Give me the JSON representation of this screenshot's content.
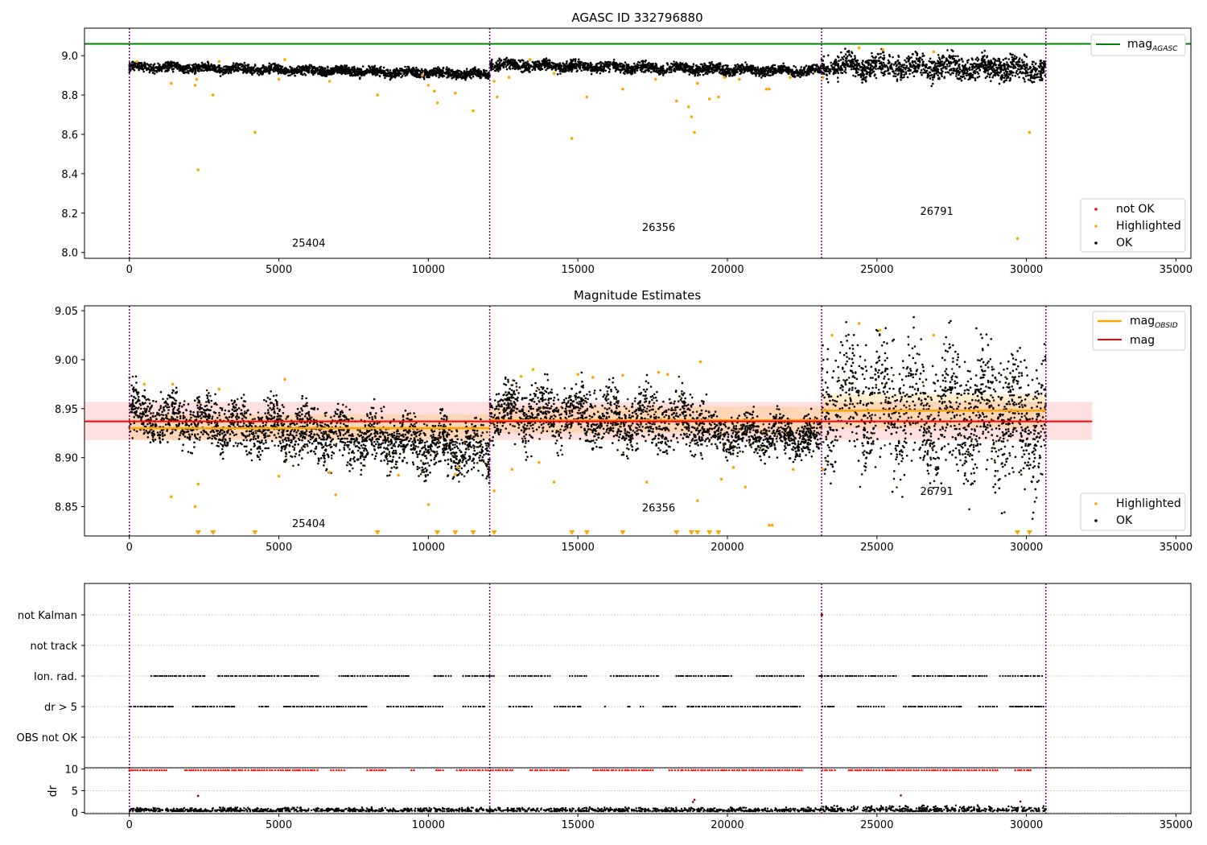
{
  "chart_data": [
    {
      "type": "scatter",
      "title": "AGASC ID 332796880",
      "xlim": [
        -1500,
        35500
      ],
      "ylim": [
        7.97,
        9.14
      ],
      "xticks": [
        0,
        5000,
        10000,
        15000,
        20000,
        25000,
        30000,
        35000
      ],
      "yticks": [
        8.0,
        8.2,
        8.4,
        8.6,
        8.8,
        9.0
      ],
      "yticklabels": [
        "8.0",
        "8.2",
        "8.4",
        "8.6",
        "8.8",
        "9.0"
      ],
      "vlines": [
        0,
        12050,
        23150,
        30650
      ],
      "segments": [
        {
          "label": "25404",
          "x": 6000,
          "y": 8.03
        },
        {
          "label": "26356",
          "x": 17700,
          "y": 8.11
        },
        {
          "label": "26791",
          "x": 27000,
          "y": 8.19
        }
      ],
      "band_means": [
        {
          "x0": 0,
          "x1": 12050,
          "y0": 8.945,
          "y1": 8.905,
          "half": 0.018
        },
        {
          "x0": 12050,
          "x1": 23150,
          "y0": 8.955,
          "y1": 8.92,
          "half": 0.02
        },
        {
          "x0": 23150,
          "x1": 30650,
          "y0": 8.95,
          "y1": 8.93,
          "half": 0.045
        }
      ],
      "mag_agasc": 9.06,
      "highlighted": [
        [
          250,
          8.97
        ],
        [
          1400,
          8.86
        ],
        [
          2200,
          8.85
        ],
        [
          2250,
          8.88
        ],
        [
          2300,
          8.42
        ],
        [
          2800,
          8.8
        ],
        [
          3000,
          8.97
        ],
        [
          4200,
          8.61
        ],
        [
          5000,
          8.88
        ],
        [
          5200,
          8.98
        ],
        [
          6700,
          8.87
        ],
        [
          8300,
          8.8
        ],
        [
          9800,
          8.9
        ],
        [
          10000,
          8.85
        ],
        [
          10200,
          8.82
        ],
        [
          10300,
          8.76
        ],
        [
          10900,
          8.81
        ],
        [
          11500,
          8.72
        ],
        [
          12200,
          8.87
        ],
        [
          12300,
          8.79
        ],
        [
          12700,
          8.89
        ],
        [
          13400,
          8.98
        ],
        [
          14200,
          8.91
        ],
        [
          14800,
          8.58
        ],
        [
          15300,
          8.79
        ],
        [
          16500,
          8.83
        ],
        [
          17600,
          8.88
        ],
        [
          18300,
          8.77
        ],
        [
          18700,
          8.74
        ],
        [
          18800,
          8.69
        ],
        [
          18900,
          8.61
        ],
        [
          19000,
          8.86
        ],
        [
          19400,
          8.78
        ],
        [
          19700,
          8.79
        ],
        [
          19900,
          8.89
        ],
        [
          20400,
          8.88
        ],
        [
          21300,
          8.83
        ],
        [
          21400,
          8.83
        ],
        [
          22100,
          8.89
        ],
        [
          23200,
          8.89
        ],
        [
          24400,
          9.04
        ],
        [
          25200,
          9.03
        ],
        [
          26900,
          9.02
        ],
        [
          29700,
          8.07
        ],
        [
          30100,
          8.61
        ]
      ],
      "legend_lines": [
        {
          "label": "mag",
          "sub": "AGASC",
          "color": "#008000"
        }
      ],
      "legend_markers": [
        {
          "label": "not OK",
          "color": "#ff0000"
        },
        {
          "label": "Highlighted",
          "color": "#ffa500"
        },
        {
          "label": "OK",
          "color": "#000000"
        }
      ]
    },
    {
      "type": "scatter",
      "title": "Magnitude Estimates",
      "xlim": [
        -1500,
        35500
      ],
      "ylim": [
        8.82,
        9.055
      ],
      "xticks": [
        0,
        5000,
        10000,
        15000,
        20000,
        25000,
        30000,
        35000
      ],
      "yticks": [
        8.85,
        8.9,
        8.95,
        9.0,
        9.05
      ],
      "yticklabels": [
        "8.85",
        "8.90",
        "8.95",
        "9.00",
        "9.05"
      ],
      "vlines": [
        0,
        12050,
        23150,
        30650
      ],
      "segments": [
        {
          "label": "25404",
          "x": 6000,
          "y": 8.829
        },
        {
          "label": "26356",
          "x": 17700,
          "y": 8.845
        },
        {
          "label": "26791",
          "x": 27000,
          "y": 8.862
        }
      ],
      "mag": 8.937,
      "mag_band": [
        8.918,
        8.957
      ],
      "mag_line_x": [
        -1500,
        32200
      ],
      "mag_obsid": [
        {
          "x0": 0,
          "x1": 12050,
          "y": 8.93,
          "lo": 8.918,
          "hi": 8.944
        },
        {
          "x0": 12050,
          "x1": 23150,
          "y": 8.938,
          "lo": 8.925,
          "hi": 8.952
        },
        {
          "x0": 23150,
          "x1": 30650,
          "y": 8.948,
          "lo": 8.93,
          "hi": 8.965
        }
      ],
      "band_means": [
        {
          "x0": 0,
          "x1": 12050,
          "y0": 8.945,
          "y1": 8.905,
          "half": 0.02
        },
        {
          "x0": 12050,
          "x1": 19300,
          "y0": 8.948,
          "y1": 8.935,
          "half": 0.022
        },
        {
          "x0": 19300,
          "x1": 23150,
          "y0": 8.925,
          "y1": 8.92,
          "half": 0.015
        },
        {
          "x0": 23150,
          "x1": 30650,
          "y0": 8.96,
          "y1": 8.935,
          "half": 0.05
        }
      ],
      "highlighted": [
        [
          500,
          8.975
        ],
        [
          1400,
          8.86
        ],
        [
          1450,
          8.975
        ],
        [
          2200,
          8.85
        ],
        [
          2300,
          8.873
        ],
        [
          3000,
          8.97
        ],
        [
          5000,
          8.881
        ],
        [
          5200,
          8.98
        ],
        [
          6700,
          8.885
        ],
        [
          6900,
          8.862
        ],
        [
          9000,
          8.882
        ],
        [
          10000,
          8.852
        ],
        [
          10900,
          8.883
        ],
        [
          11000,
          8.89
        ],
        [
          12200,
          8.866
        ],
        [
          12800,
          8.888
        ],
        [
          13100,
          8.983
        ],
        [
          13500,
          8.99
        ],
        [
          13700,
          8.895
        ],
        [
          14200,
          8.875
        ],
        [
          15000,
          8.985
        ],
        [
          15500,
          8.982
        ],
        [
          16500,
          8.984
        ],
        [
          17300,
          8.875
        ],
        [
          17700,
          8.987
        ],
        [
          18000,
          8.985
        ],
        [
          19000,
          8.856
        ],
        [
          19100,
          8.998
        ],
        [
          19800,
          8.878
        ],
        [
          20200,
          8.89
        ],
        [
          20600,
          8.87
        ],
        [
          21400,
          8.831
        ],
        [
          21500,
          8.831
        ],
        [
          22200,
          8.888
        ],
        [
          23200,
          8.888
        ],
        [
          23500,
          9.025
        ],
        [
          24400,
          9.037
        ],
        [
          25100,
          9.03
        ],
        [
          26900,
          9.025
        ]
      ],
      "offscale": [
        2300,
        2800,
        4200,
        8300,
        10300,
        10900,
        11500,
        12200,
        14800,
        15300,
        16500,
        18300,
        18800,
        19000,
        19400,
        19700,
        29700,
        30100
      ],
      "legend_lines": [
        {
          "label": "mag",
          "sub": "OBSID",
          "color": "#ffa500"
        },
        {
          "label": "mag",
          "sub": "",
          "color": "#ff0000"
        }
      ],
      "legend_markers": [
        {
          "label": "Highlighted",
          "color": "#ffa500"
        },
        {
          "label": "OK",
          "color": "#000000"
        }
      ]
    },
    {
      "type": "scatter",
      "title": "",
      "xlim": [
        -1500,
        35500
      ],
      "vlines": [
        0,
        12050,
        23150,
        30650
      ],
      "categories": [
        "not Kalman",
        "not track",
        "Ion. rad.",
        "dr > 5",
        "OBS not OK"
      ],
      "flag_rows": [
        "Ion. rad.",
        "dr > 5"
      ],
      "not_kalman_points": [
        [
          23160,
          "not Kalman"
        ]
      ]
    },
    {
      "type": "scatter",
      "title": "",
      "xlim": [
        -1500,
        35500
      ],
      "ylim": [
        -0.3,
        10.3
      ],
      "xticks": [
        0,
        5000,
        10000,
        15000,
        20000,
        25000,
        30000,
        35000
      ],
      "yticks": [
        0,
        5,
        10
      ],
      "yticklabels": [
        "0",
        "5",
        "10"
      ],
      "ylabel": "dr",
      "vlines": [
        0,
        12050,
        23150,
        30650
      ],
      "dr_outliers": [
        [
          2300,
          3.8
        ],
        [
          18850,
          2.4
        ],
        [
          18900,
          2.9
        ],
        [
          25800,
          3.9
        ],
        [
          29800,
          2.5
        ]
      ]
    }
  ]
}
